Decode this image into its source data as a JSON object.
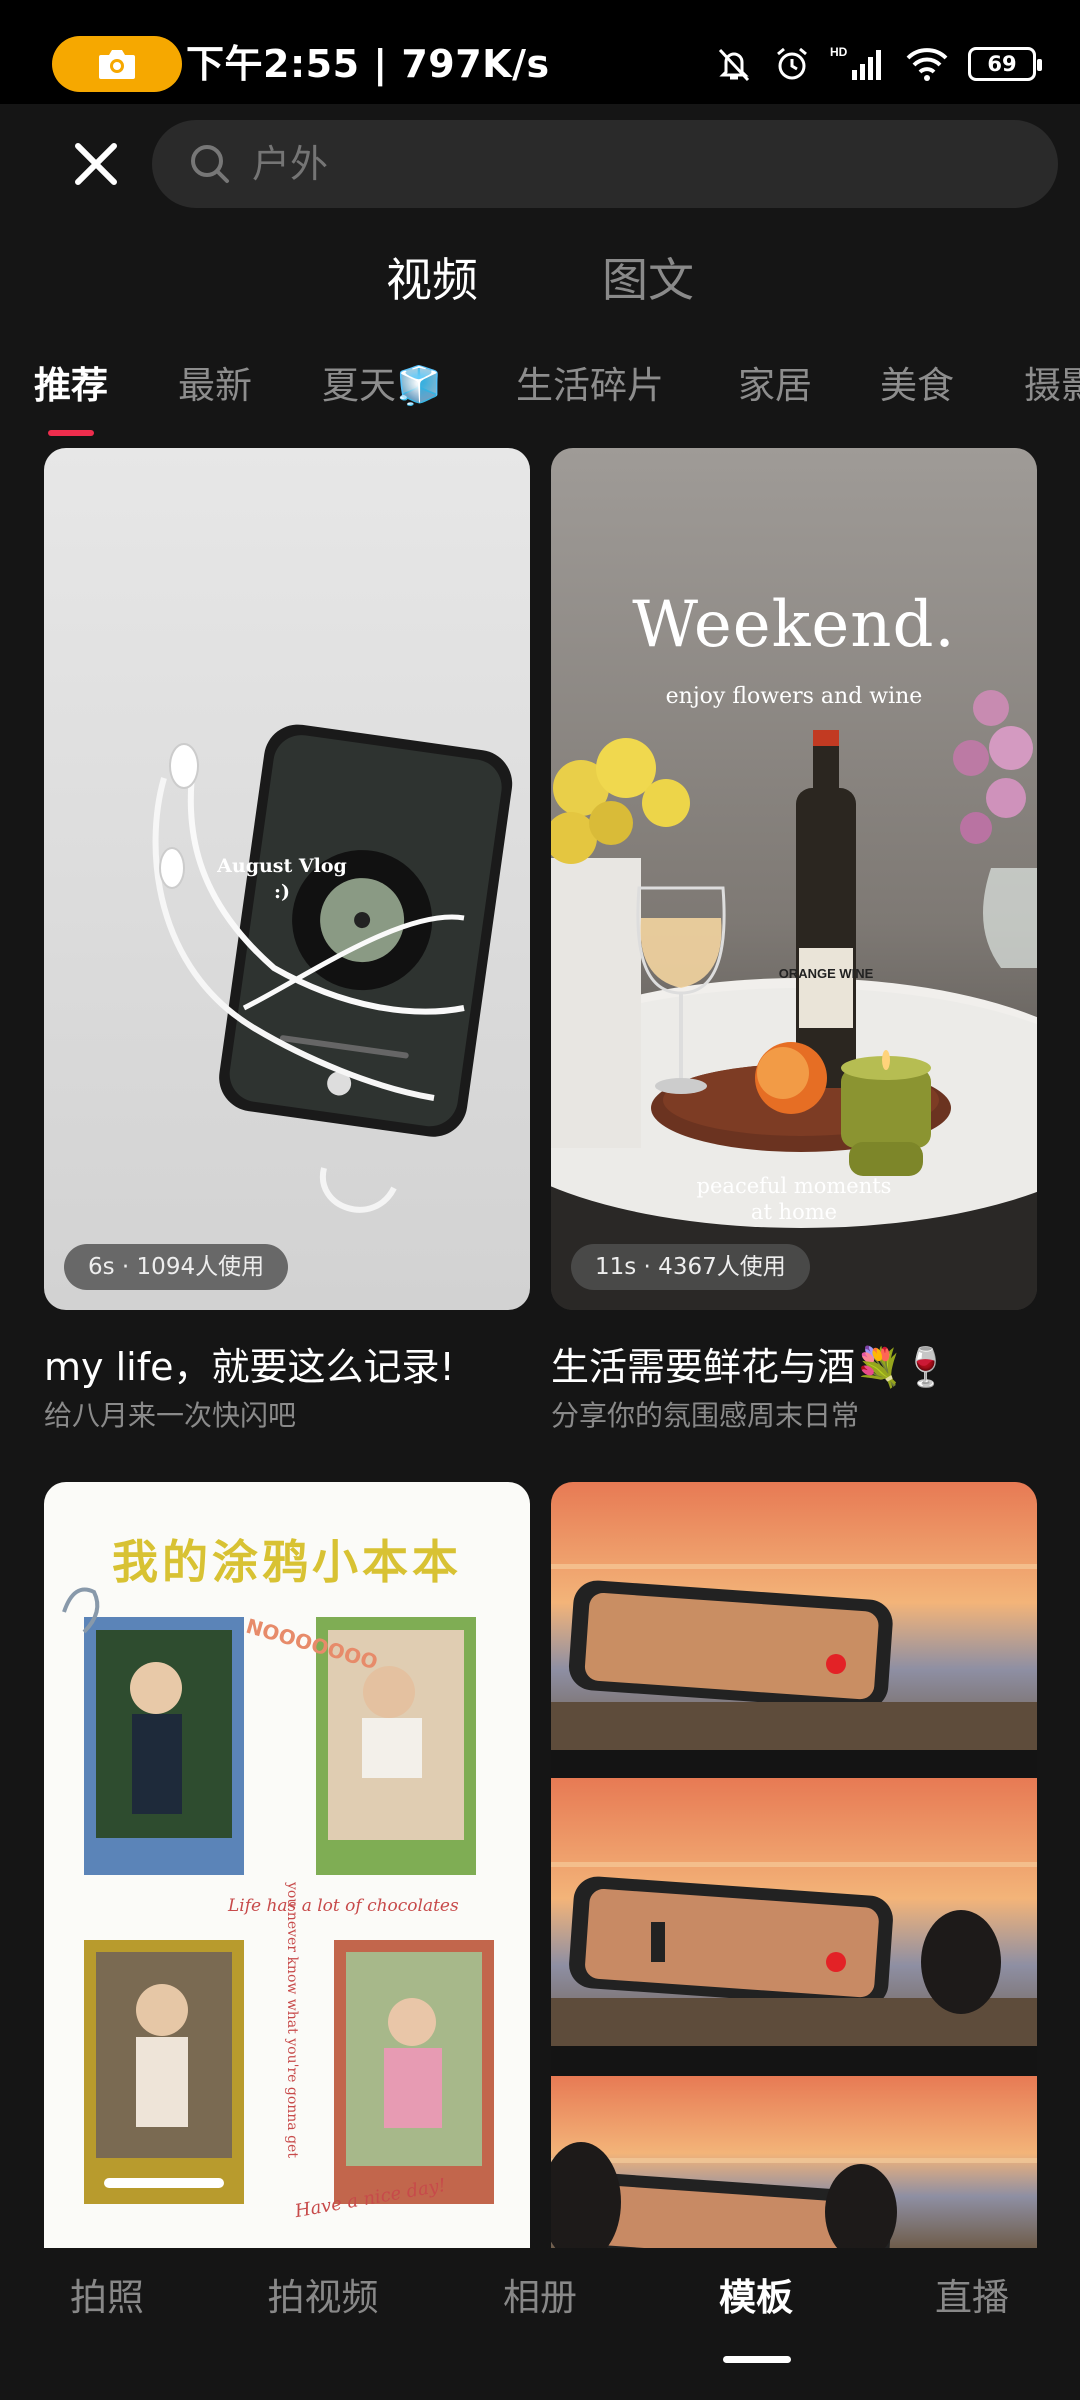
{
  "status_bar": {
    "text": "下午2:55 | 797K/s",
    "battery": "69",
    "hd_label": "HD"
  },
  "search": {
    "placeholder": "户外"
  },
  "type_tabs": [
    {
      "label": "视频",
      "active": true
    },
    {
      "label": "图文",
      "active": false
    }
  ],
  "categories": [
    {
      "label": "推荐",
      "active": true
    },
    {
      "label": "最新",
      "active": false
    },
    {
      "label": "夏天🧊",
      "active": false
    },
    {
      "label": "生活碎片",
      "active": false
    },
    {
      "label": "家居",
      "active": false
    },
    {
      "label": "美食",
      "active": false
    },
    {
      "label": "摄影",
      "active": false
    }
  ],
  "cards": [
    {
      "badge": "6s · 1094人使用",
      "title": "my life，就要这么记录!",
      "subtitle": "给八月来一次快闪吧",
      "overlay": "August Vlog\n:)"
    },
    {
      "badge": "11s · 4367人使用",
      "title": "生活需要鲜花与酒💐🍷",
      "subtitle": "分享你的氛围感周末日常",
      "overlay_title": "Weekend.",
      "overlay_sub": "enjoy flowers and wine",
      "overlay_bottom_1": "peaceful moments",
      "overlay_bottom_2": "at home",
      "bottle_label": "ORANGE WINE"
    },
    {
      "overlay_title": "我的涂鸦小本本",
      "overlay_stamp": "NOOOOOOO",
      "overlay_note": "Life has a lot of chocolates",
      "overlay_side": "you never know what you're gonna get",
      "overlay_bottom": "Have a nice day!"
    },
    {}
  ],
  "bottom_nav": [
    {
      "label": "拍照",
      "active": false
    },
    {
      "label": "拍视频",
      "active": false
    },
    {
      "label": "相册",
      "active": false
    },
    {
      "label": "模板",
      "active": true
    },
    {
      "label": "直播",
      "active": false
    }
  ],
  "colors": {
    "accent_red": "#ee2d4d",
    "camera_pill": "#f6a800",
    "background": "#151515"
  }
}
